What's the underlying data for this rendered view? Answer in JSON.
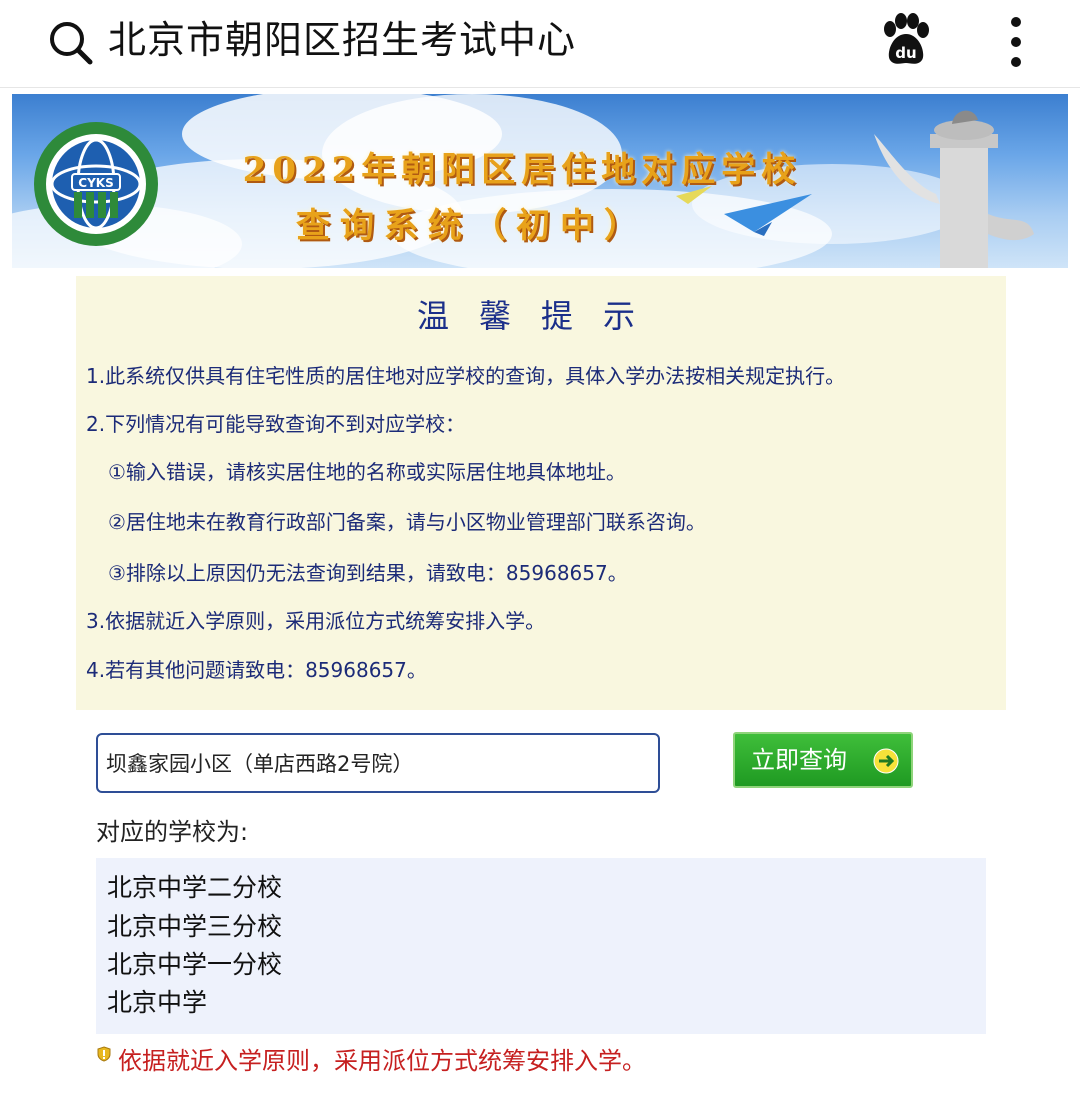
{
  "topbar": {
    "title": "北京市朝阳区招生考试中心",
    "search_icon": "search-icon",
    "baidu_icon": "baidu-paw-icon",
    "more_icon": "more-vertical-icon"
  },
  "banner": {
    "logo_text": "CYKS",
    "headline_line1": "2022年朝阳区居住地对应学校",
    "headline_line2": "查询系统（初中）"
  },
  "tips": {
    "title": "温馨提示",
    "lines": [
      "1.此系统仅供具有住宅性质的居住地对应学校的查询，具体入学办法按相关规定执行。",
      "2.下列情况有可能导致查询不到对应学校：",
      "①输入错误，请核实居住地的名称或实际居住地具体地址。",
      "②居住地未在教育行政部门备案，请与小区物业管理部门联系咨询。",
      "③排除以上原因仍无法查询到结果，请致电：85968657。",
      "3.依据就近入学原则，采用派位方式统筹安排入学。",
      "4.若有其他问题请致电：85968657。"
    ]
  },
  "query": {
    "input_value": "坝鑫家园小区（单店西路2号院）",
    "button_label": "立即查询"
  },
  "result": {
    "label": "对应的学校为:",
    "schools": [
      "北京中学二分校",
      "北京中学三分校",
      "北京中学一分校",
      "北京中学"
    ]
  },
  "notice": {
    "text": "依据就近入学原则，采用派位方式统筹安排入学。"
  },
  "colors": {
    "tips_bg": "#f9f7df",
    "tips_text": "#1c2b78",
    "button_green": "#2aab2c",
    "results_bg": "#eef2fc",
    "notice_red": "#c62020"
  }
}
